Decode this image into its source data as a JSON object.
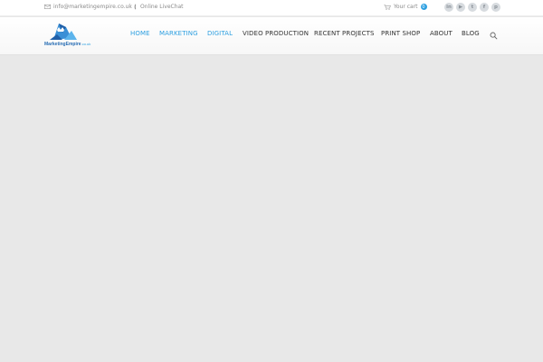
{
  "topbar": {
    "email": "info@marketingempire.co.uk",
    "chat": "Online LiveChat",
    "cart_label": "Your cart",
    "cart_count": "0"
  },
  "socials": [
    {
      "name": "linkedin",
      "glyph": "in"
    },
    {
      "name": "youtube",
      "glyph": "▶"
    },
    {
      "name": "twitter",
      "glyph": "t"
    },
    {
      "name": "facebook",
      "glyph": "f"
    },
    {
      "name": "pinterest",
      "glyph": "p"
    }
  ],
  "logo": {
    "main": "MarketingEmpire",
    "suffix": ".co.uk"
  },
  "nav": {
    "items": [
      {
        "label": "HOME"
      },
      {
        "label": "MARKETING"
      },
      {
        "label": "DIGITAL"
      },
      {
        "label": "VIDEO PRODUCTION"
      },
      {
        "label": "RECENT PROJECTS"
      },
      {
        "label": "PRINT SHOP"
      },
      {
        "label": "ABOUT"
      },
      {
        "label": "BLOG"
      }
    ]
  },
  "colors": {
    "accent": "#2d9fe0",
    "logo_blue": "#2a6fb5",
    "background": "#e8e8e8"
  }
}
